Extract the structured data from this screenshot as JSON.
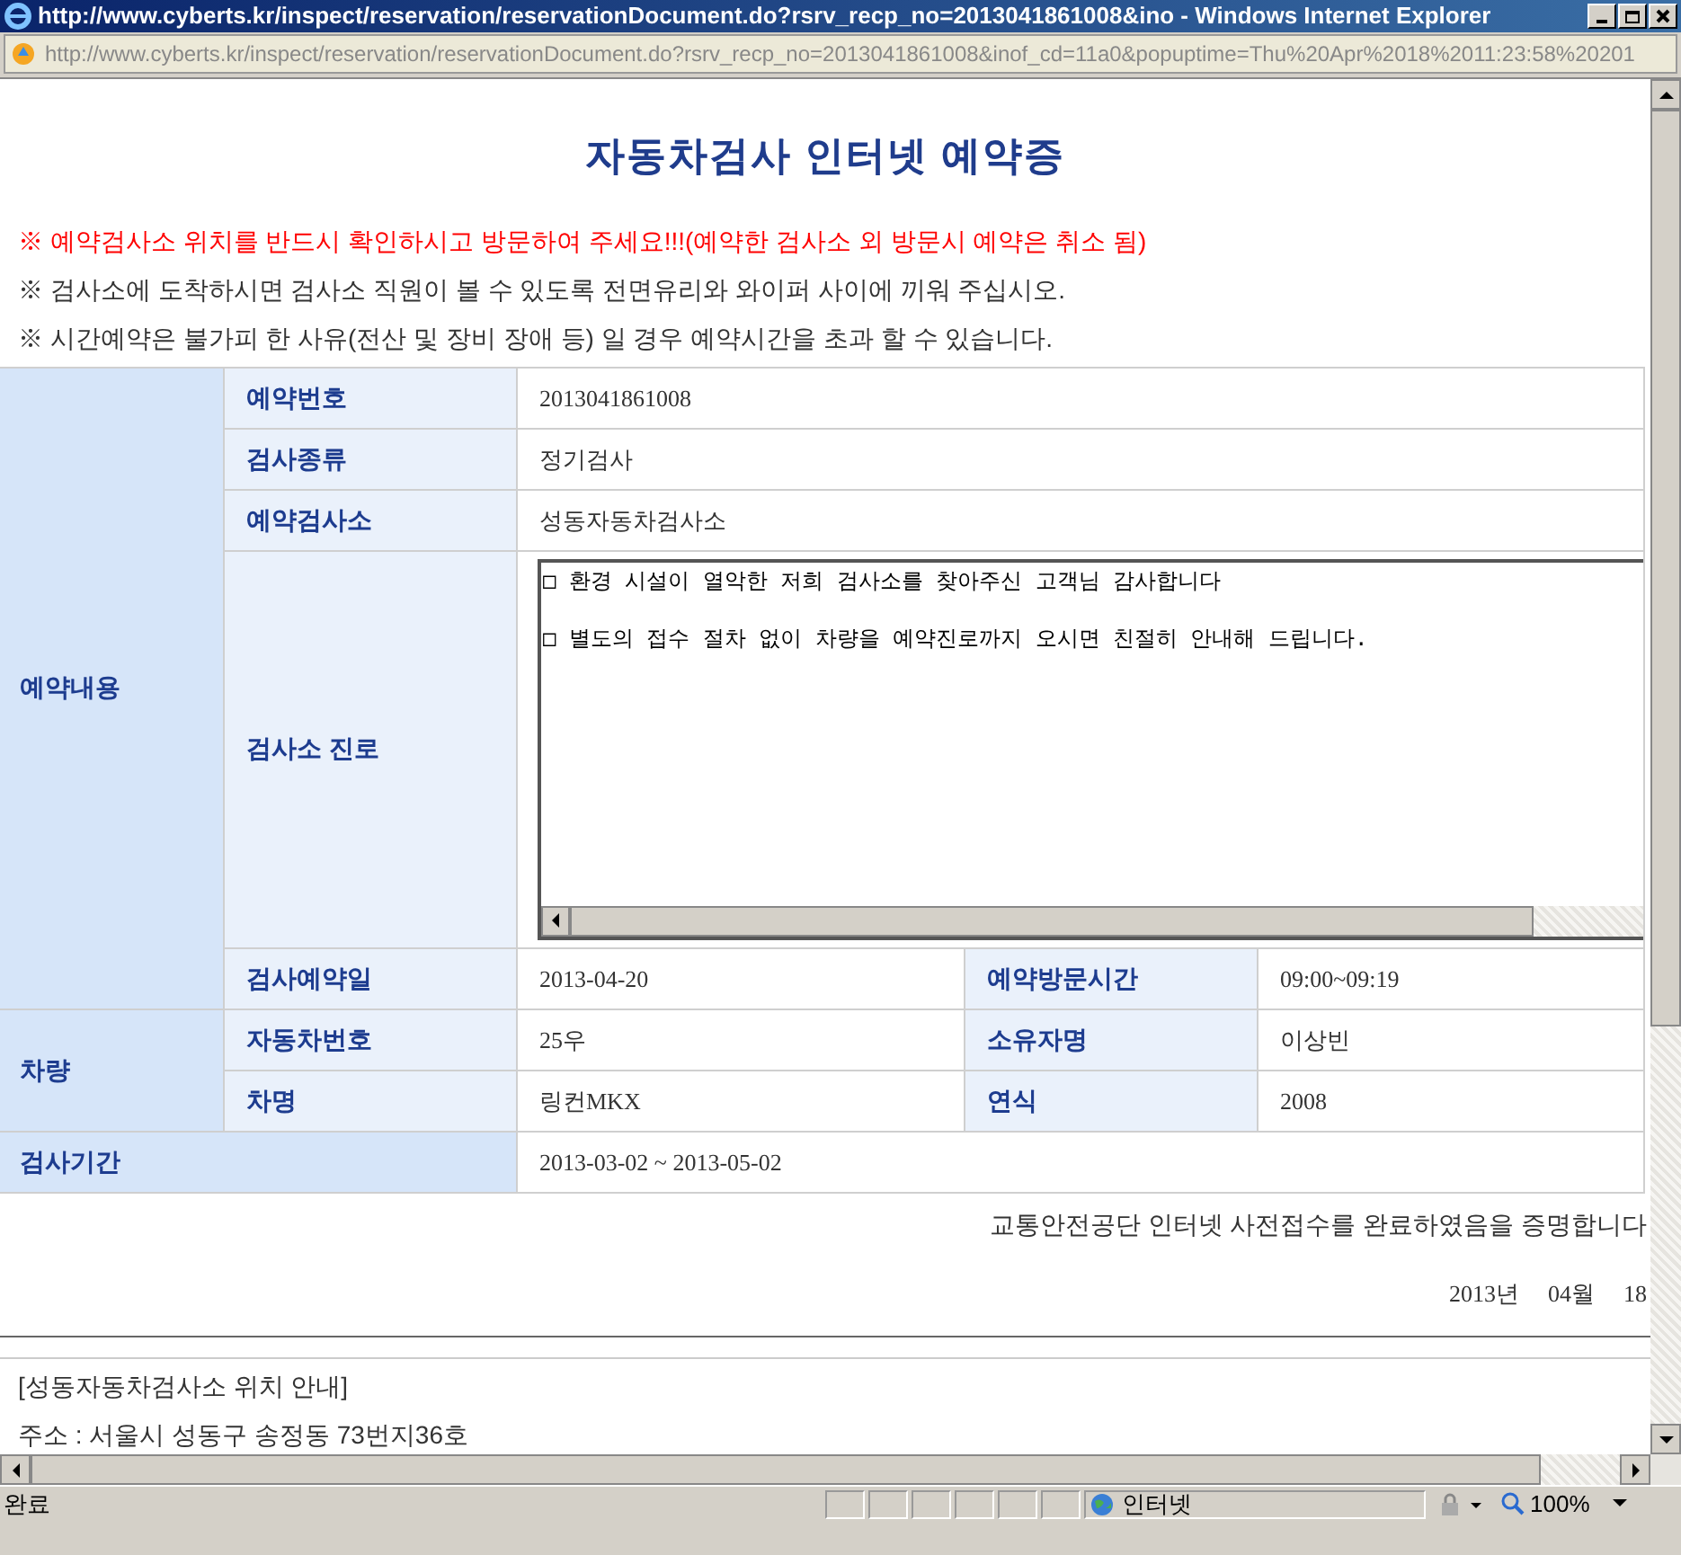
{
  "window": {
    "title": "http://www.cyberts.kr/inspect/reservation/reservationDocument.do?rsrv_recp_no=2013041861008&ino - Windows Internet Explorer"
  },
  "address_bar": {
    "url": "http://www.cyberts.kr/inspect/reservation/reservationDocument.do?rsrv_recp_no=2013041861008&inof_cd=11a0&popuptime=Thu%20Apr%2018%2011:23:58%20201"
  },
  "page_title": "자동차검사 인터넷 예약증",
  "notices": [
    {
      "kind": "warning",
      "text": "※ 예약검사소 위치를 반드시 확인하시고 방문하여 주세요!!!(예약한 검사소 외 방문시 예약은 취소 됨)"
    },
    {
      "kind": "normal",
      "text": "※ 검사소에 도착하시면 검사소 직원이 볼 수 있도록 전면유리와 와이퍼 사이에 끼워 주십시오."
    },
    {
      "kind": "normal",
      "text": "※ 시간예약은 불가피 한 사유(전산 및 장비 장애 등) 일 경우 예약시간을 초과 할 수 있습니다."
    }
  ],
  "groups": [
    {
      "label": "예약내용",
      "rows": [
        {
          "kind": "single",
          "label": "예약번호",
          "value": "2013041861008"
        },
        {
          "kind": "single",
          "label": "검사종류",
          "value": "정기검사"
        },
        {
          "kind": "single",
          "label": "예약검사소",
          "value": "성동자동차검사소"
        },
        {
          "kind": "textarea",
          "label": "검사소 진로",
          "lines": [
            "□ 환경 시설이 열악한 저희 검사소를 찾아주신 고객님 감사합니다",
            "□ 별도의 접수 절차 없이 차량을 예약진로까지 오시면 친절히 안내해 드립니다."
          ]
        },
        {
          "kind": "pair",
          "label": "검사예약일",
          "value": "2013-04-20",
          "label2": "예약방문시간",
          "value2": "09:00~09:19"
        }
      ]
    },
    {
      "label": "차량",
      "rows": [
        {
          "kind": "pair",
          "label": "자동차번호",
          "value": "25우",
          "label2": "소유자명",
          "value2": "이상빈"
        },
        {
          "kind": "pair",
          "label": "차명",
          "value": "링컨MKX",
          "label2": "연식",
          "value2": "2008"
        }
      ]
    }
  ],
  "inspection_period": {
    "label": "검사기간",
    "value": "2013-03-02 ~ 2013-05-02"
  },
  "certification": "교통안전공단 인터넷 사전접수를 완료하였음을 증명합니다",
  "date_parts": [
    "2013년",
    "04월",
    "18"
  ],
  "location": {
    "heading": "[성동자동차검사소 위치 안내]",
    "address": "주소 : 서울시 성동구 송정동 73번지36호"
  },
  "status_bar": {
    "status": "완료",
    "zone": "인터넷",
    "zoom": "100%"
  }
}
